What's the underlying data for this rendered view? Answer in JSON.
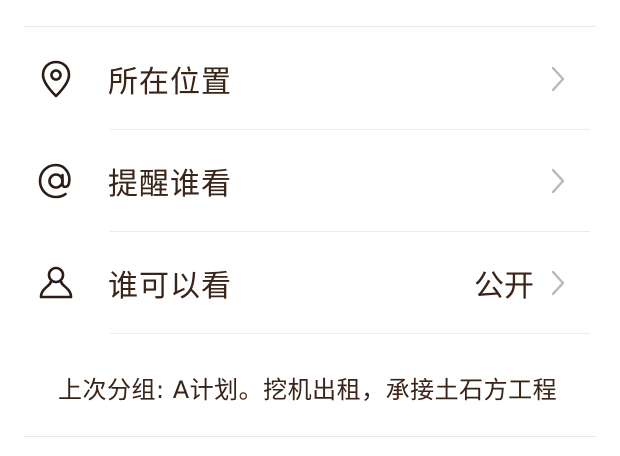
{
  "rows": [
    {
      "id": "location",
      "label": "所在位置",
      "value": "",
      "icon": "location-pin-icon"
    },
    {
      "id": "mention",
      "label": "提醒谁看",
      "value": "",
      "icon": "at-icon"
    },
    {
      "id": "visibility",
      "label": "谁可以看",
      "value": "公开",
      "icon": "person-icon"
    }
  ],
  "group_note": "上次分组: A计划。挖机出租，承接土石方工程",
  "colors": {
    "text": "#3a2418",
    "divider": "#ececec",
    "chevron": "#b8b8b8"
  }
}
